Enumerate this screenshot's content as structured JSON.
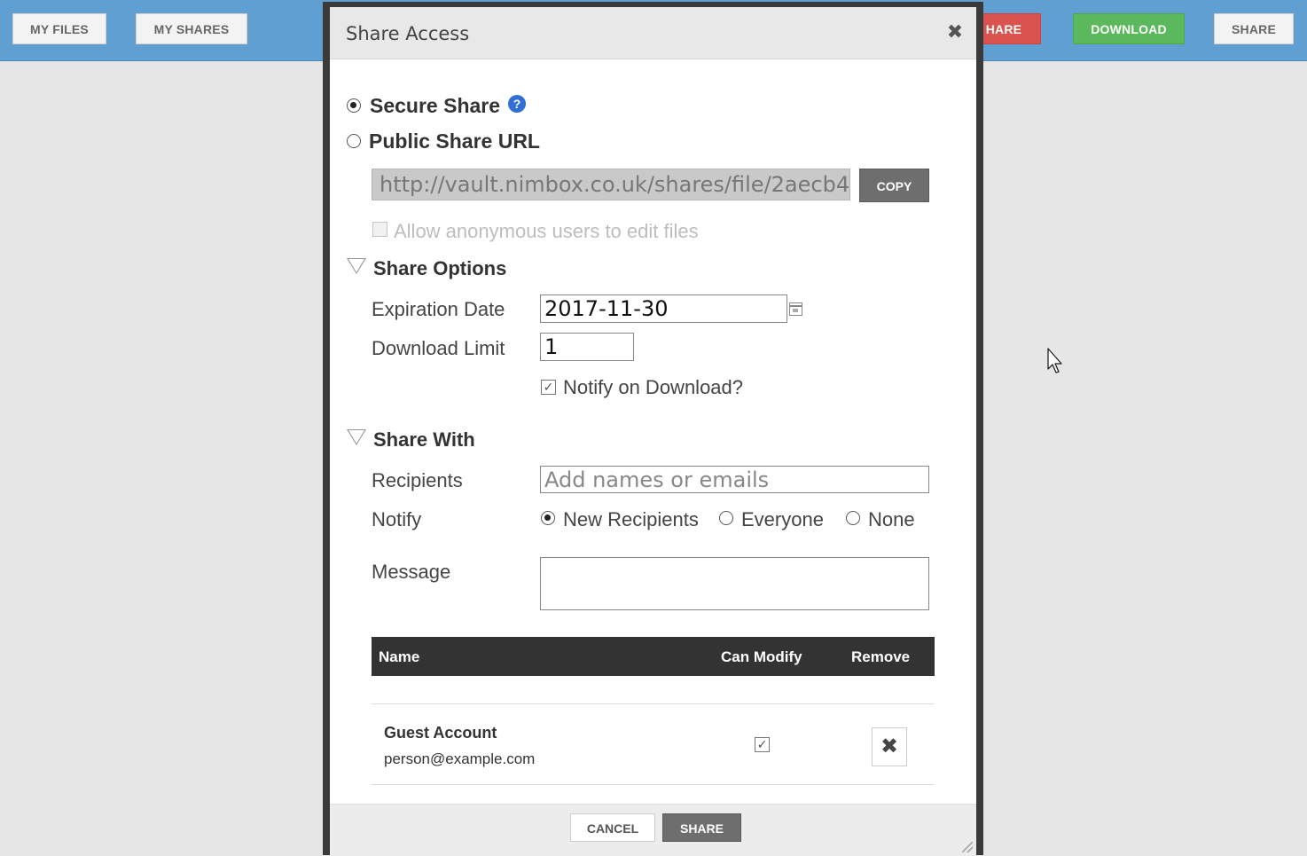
{
  "topbar": {
    "my_files": "MY FILES",
    "my_shares": "MY SHARES",
    "unshare_partial": "HARE",
    "download": "DOWNLOAD",
    "share": "SHARE"
  },
  "dialog": {
    "title": "Share Access",
    "close_symbol": "✖",
    "secure_share_label": "Secure Share",
    "help_symbol": "?",
    "public_share_label": "Public Share URL",
    "public_url": "http://vault.nimbox.co.uk/shares/file/2aecb4",
    "copy_label": "COPY",
    "allow_anonymous_label": "Allow anonymous users to edit files",
    "share_options_title": "Share Options",
    "expiration_label": "Expiration Date",
    "expiration_value": "2017-11-30",
    "download_limit_label": "Download Limit",
    "download_limit_value": "1",
    "notify_on_download_label": "Notify on Download?",
    "check_symbol": "✓",
    "share_with_title": "Share With",
    "recipients_label": "Recipients",
    "recipients_placeholder": "Add names or emails",
    "notify_label": "Notify",
    "notify_options": [
      "New Recipients",
      "Everyone",
      "None"
    ],
    "message_label": "Message",
    "table": {
      "headers": [
        "Name",
        "Can Modify",
        "Remove"
      ],
      "rows": [
        {
          "name": "Guest Account",
          "email": "person@example.com",
          "remove_symbol": "✖"
        }
      ]
    },
    "cancel_label": "CANCEL",
    "share_label": "SHARE"
  }
}
